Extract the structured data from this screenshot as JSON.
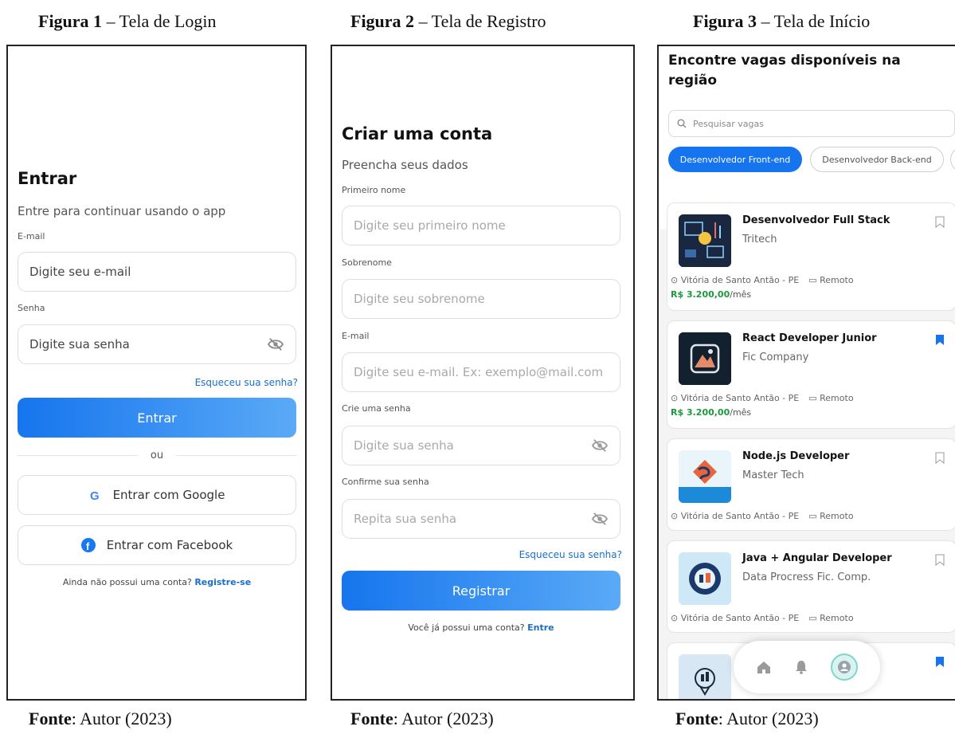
{
  "figures": [
    {
      "number": "Figura 1",
      "caption": " – Tela de Login",
      "source_label": "Fonte",
      "source_text": ": Autor (2023)"
    },
    {
      "number": "Figura 2",
      "caption": " – Tela de Registro",
      "source_label": "Fonte",
      "source_text": ": Autor (2023)"
    },
    {
      "number": "Figura 3",
      "caption": " – Tela de Início",
      "source_label": "Fonte",
      "source_text": ": Autor (2023)"
    }
  ],
  "login": {
    "title": "Entrar",
    "subtitle": "Entre para continuar usando o app",
    "email_label": "E-mail",
    "email_placeholder": "Digite seu e-mail",
    "password_label": "Senha",
    "password_placeholder": "Digite sua senha",
    "forgot": "Esqueceu sua senha?",
    "submit": "Entrar",
    "or": "ou",
    "google": "Entrar com Google",
    "facebook": "Entrar com Facebook",
    "footer_text": "Ainda não possui uma conta?",
    "footer_link": "Registre-se"
  },
  "register": {
    "title": "Criar uma conta",
    "subtitle": "Preencha seus dados",
    "first_name_label": "Primeiro nome",
    "first_name_placeholder": "Digite seu primeiro nome",
    "last_name_label": "Sobrenome",
    "last_name_placeholder": "Digite seu sobrenome",
    "email_label": "E-mail",
    "email_placeholder": "Digite seu e-mail. Ex: exemplo@mail.com",
    "password_label": "Crie uma senha",
    "password_placeholder": "Digite sua senha",
    "confirm_label": "Confirme sua senha",
    "confirm_placeholder": "Repita sua senha",
    "forgot": "Esqueceu sua senha?",
    "submit": "Registrar",
    "footer_text": "Você já possui uma conta?",
    "footer_link": "Entre"
  },
  "home": {
    "title_line1": "Encontre vagas disponíveis na",
    "title_line2": "região",
    "search_placeholder": "Pesquisar vagas",
    "chips": [
      "Desenvolvedor Front-end",
      "Desenvolvedor Back-end"
    ],
    "jobs": [
      {
        "title": "Desenvolvedor Full Stack",
        "company": "Tritech",
        "location": "Vitória de Santo Antão - PE",
        "mode": "Remoto",
        "salary": "R$ 3.200,00",
        "salary_unit": "/mês",
        "bookmarked": false,
        "logo_bg": "#1a2740"
      },
      {
        "title": "React Developer Junior",
        "company": "Fic Company",
        "location": "Vitória de Santo Antão - PE",
        "mode": "Remoto",
        "salary": "R$ 3.200,00",
        "salary_unit": "/mês",
        "bookmarked": true,
        "logo_bg": "#13202e"
      },
      {
        "title": "Node.js Developer",
        "company": "Master Tech",
        "location": "Vitória de Santo Antão - PE",
        "mode": "Remoto",
        "salary": "",
        "salary_unit": "",
        "bookmarked": false,
        "logo_bg": "#eaf4fb"
      },
      {
        "title": "Java + Angular Developer",
        "company": "Data Procress Fic. Comp.",
        "location": "Vitória de Santo Antão - PE",
        "mode": "Remoto",
        "salary": "",
        "salary_unit": "",
        "bookmarked": false,
        "logo_bg": "#cfe8f7"
      },
      {
        "title": "",
        "company": "",
        "location": "",
        "mode": "",
        "salary": "",
        "salary_unit": "",
        "bookmarked": true,
        "logo_bg": "#d7e8f4"
      }
    ],
    "nav": [
      "home-icon",
      "bell-icon",
      "profile-icon"
    ]
  },
  "colors": {
    "primary": "#1675ee",
    "link": "#1a6fc8",
    "salary": "#1a9a3a",
    "bookmark_active": "#1675ee"
  }
}
